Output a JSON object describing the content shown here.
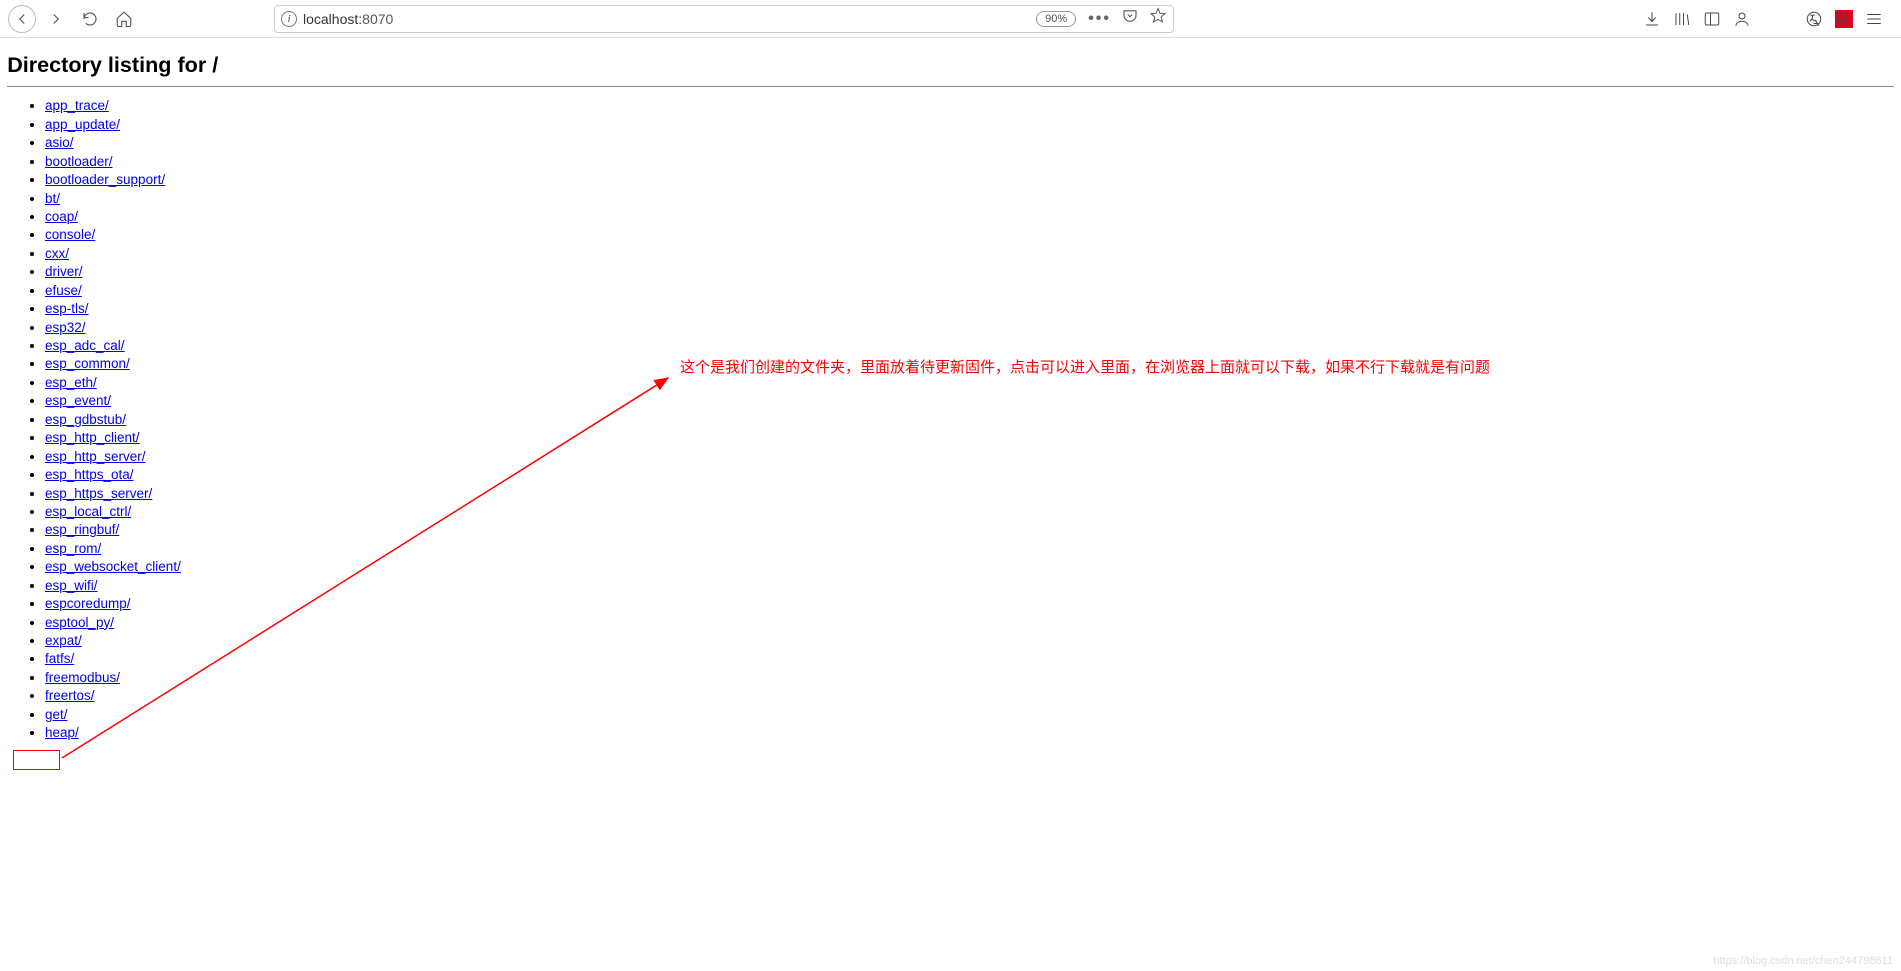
{
  "browser": {
    "url_host": "localhost:",
    "url_port": "8070",
    "zoom": "90%"
  },
  "page": {
    "title": "Directory listing for /"
  },
  "directories": [
    "app_trace/",
    "app_update/",
    "asio/",
    "bootloader/",
    "bootloader_support/",
    "bt/",
    "coap/",
    "console/",
    "cxx/",
    "driver/",
    "efuse/",
    "esp-tls/",
    "esp32/",
    "esp_adc_cal/",
    "esp_common/",
    "esp_eth/",
    "esp_event/",
    "esp_gdbstub/",
    "esp_http_client/",
    "esp_http_server/",
    "esp_https_ota/",
    "esp_https_server/",
    "esp_local_ctrl/",
    "esp_ringbuf/",
    "esp_rom/",
    "esp_websocket_client/",
    "esp_wifi/",
    "espcoredump/",
    "esptool_py/",
    "expat/",
    "fatfs/",
    "freemodbus/",
    "freertos/",
    "get/",
    "heap/"
  ],
  "annotation": {
    "text": "这个是我们创建的文件夹，里面放着待更新固件，点击可以进入里面，在浏览器上面就可以下载，如果不行下载就是有问题"
  },
  "watermark": "https://blog.csdn.net/chen244798611"
}
